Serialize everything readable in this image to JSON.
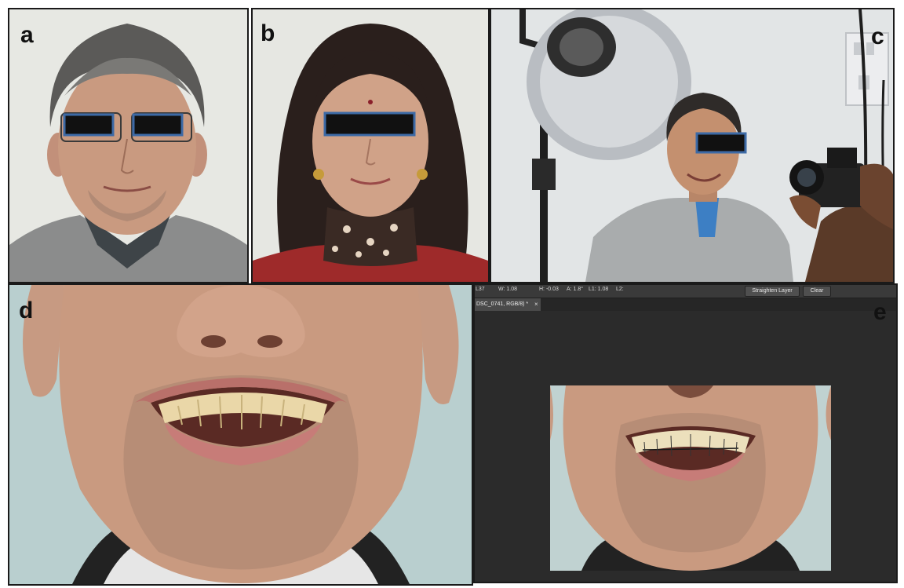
{
  "panels": {
    "a": {
      "label": "a"
    },
    "b": {
      "label": "b"
    },
    "c": {
      "label": "c"
    },
    "d": {
      "label": "d"
    },
    "e": {
      "label": "e"
    }
  },
  "editor": {
    "options_bar": {
      "l": "L37",
      "w": "W: 1.08",
      "h": "H: -0.03",
      "a": "A: 1.8°",
      "l1": "L1: 1.08",
      "l2": "L2:",
      "straighten_label": "Straighten Layer",
      "clear_label": "Clear"
    },
    "document_tab": "DSC_0741, RGB/8) *",
    "tab_close": "×"
  },
  "colors": {
    "panel_border": "#1a1a1a",
    "eye_bar": "#111111",
    "eye_bar_outline": "#3d6aa6",
    "editor_bg": "#2b2b2b",
    "skin": "#c99a80",
    "wall": "#e6e8e3"
  }
}
